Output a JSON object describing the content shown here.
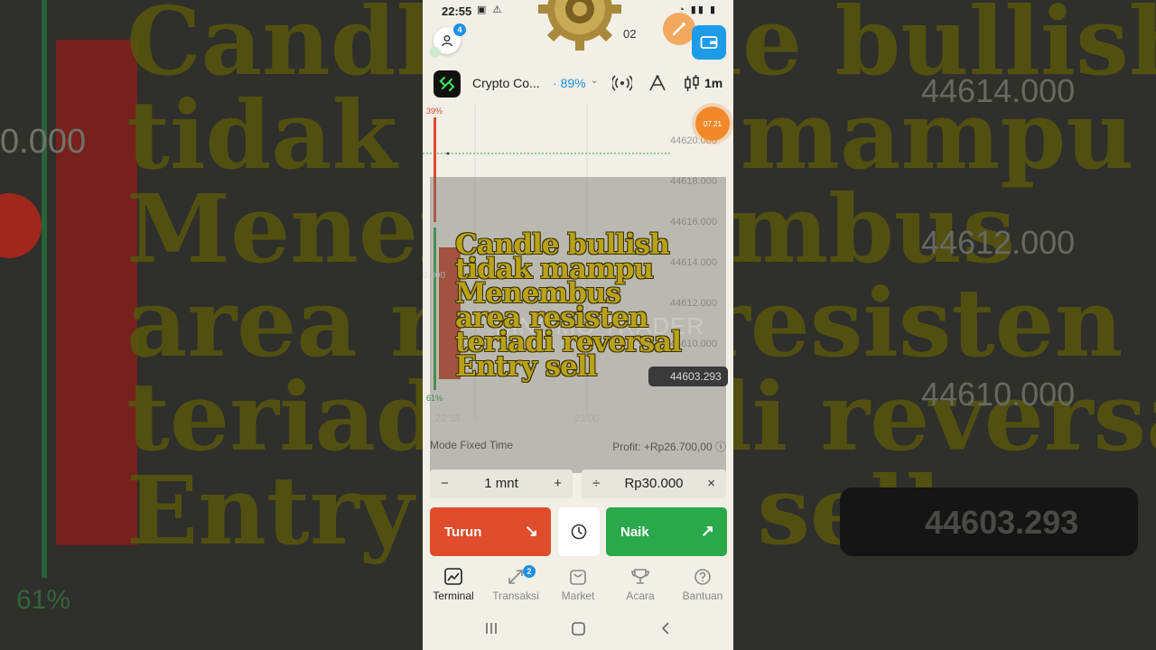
{
  "background": {
    "caption_lines": [
      "Candle bullish",
      "tidak mampu",
      "Menembus",
      "area resisten",
      "teriadi reversal",
      "Entry sell"
    ],
    "price_labels": [
      "44614.000",
      "44612.000",
      "44610.000"
    ],
    "left_price": "0.000",
    "pill_value": "44603.293",
    "percent_bottom": "61%"
  },
  "status_bar": {
    "time": "22:55"
  },
  "header": {
    "notification_count": "4",
    "hidden_number": "02"
  },
  "asset": {
    "name": "Crypto Co...",
    "payout": "89%",
    "timeframe": "1m"
  },
  "chart": {
    "price_levels": [
      "44620.000",
      "44618.000",
      "44616.000",
      "44614.000",
      "44612.000",
      "44610.000"
    ],
    "current_bid": "44603.293",
    "percent_up": "39%",
    "percent_down": "61%",
    "timer": "07.21",
    "time_start": "22:55",
    "time_end": "23:00",
    "watermark": "BINOMO TRADER",
    "left_price": "0.000"
  },
  "caption": {
    "lines": [
      "Candle bullish",
      "tidak mampu",
      "Menembus",
      "area resisten",
      "teriadi reversal",
      "Entry sell"
    ]
  },
  "trade": {
    "mode": "Mode Fixed Time",
    "profit": "Profit: +Rp26.700,00",
    "duration": "1 mnt",
    "amount": "Rp30.000",
    "minus": "−",
    "plus": "+",
    "divide": "÷",
    "multiply": "×",
    "down_label": "Turun",
    "up_label": "Naik"
  },
  "nav": {
    "items": [
      {
        "label": "Terminal",
        "icon": "chart-icon"
      },
      {
        "label": "Transaksi",
        "icon": "arrows-icon",
        "badge": "2"
      },
      {
        "label": "Market",
        "icon": "bag-icon"
      },
      {
        "label": "Acara",
        "icon": "trophy-icon"
      },
      {
        "label": "Bantuan",
        "icon": "help-icon"
      }
    ]
  },
  "colors": {
    "accent_blue": "#1e90e6",
    "down_red": "#df4c2c",
    "up_green": "#2aa84a",
    "caption_yellow": "#b9a11a"
  }
}
